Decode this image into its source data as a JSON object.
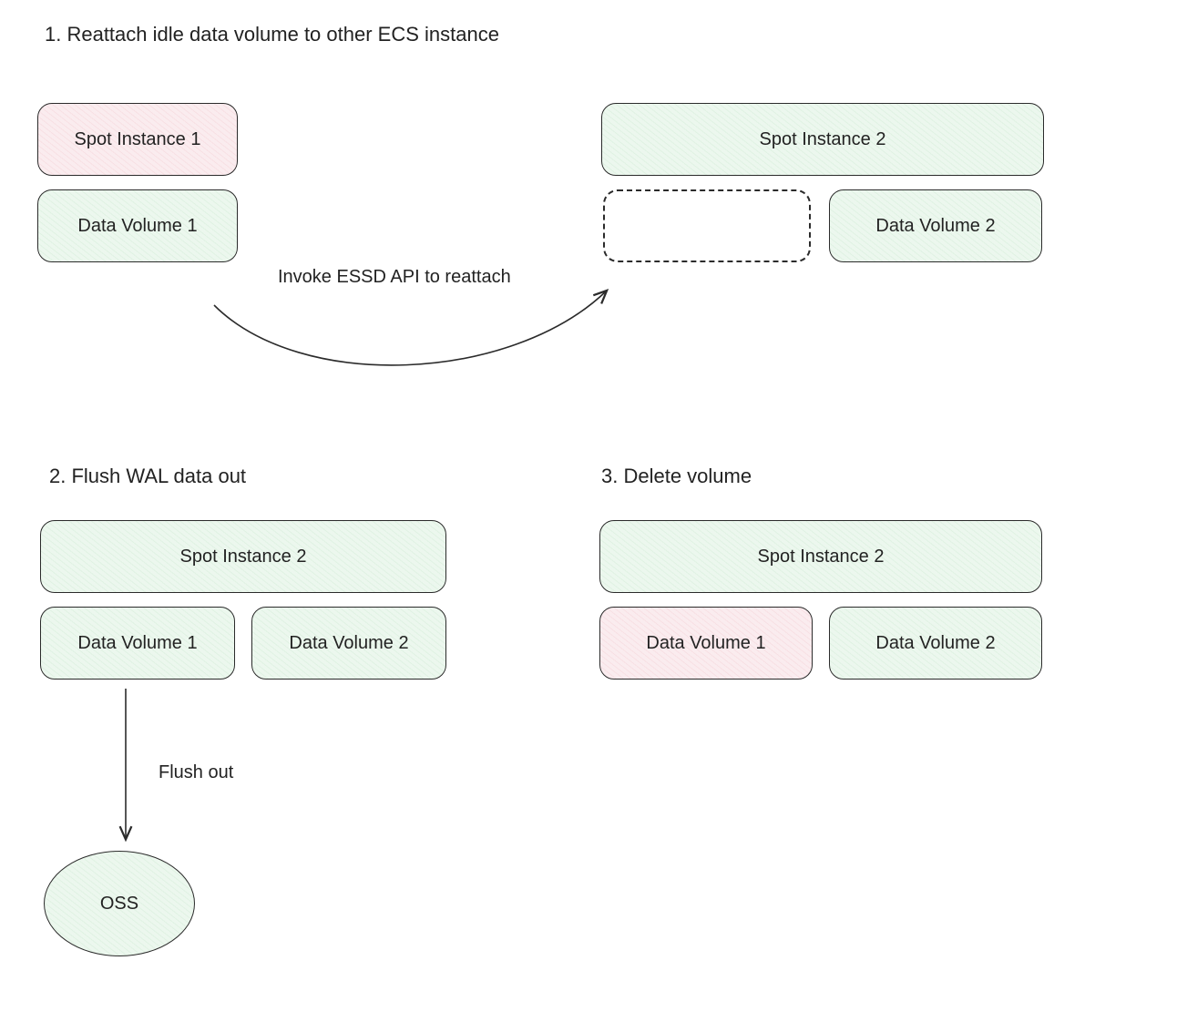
{
  "section1": {
    "title": "1. Reattach idle data volume to other ECS instance",
    "left_top_box": "Spot Instance 1",
    "left_bottom_box": "Data Volume 1",
    "right_top_box": "Spot Instance 2",
    "right_bottom_box": "Data Volume 2",
    "arrow_label": "Invoke ESSD API to reattach"
  },
  "section2": {
    "title": "2. Flush WAL data out",
    "top_box": "Spot Instance 2",
    "left_box": "Data Volume 1",
    "right_box": "Data Volume 2",
    "arrow_label": "Flush out",
    "ellipse": "OSS"
  },
  "section3": {
    "title": "3. Delete volume",
    "top_box": "Spot Instance 2",
    "left_box": "Data Volume 1",
    "right_box": "Data Volume 2"
  }
}
